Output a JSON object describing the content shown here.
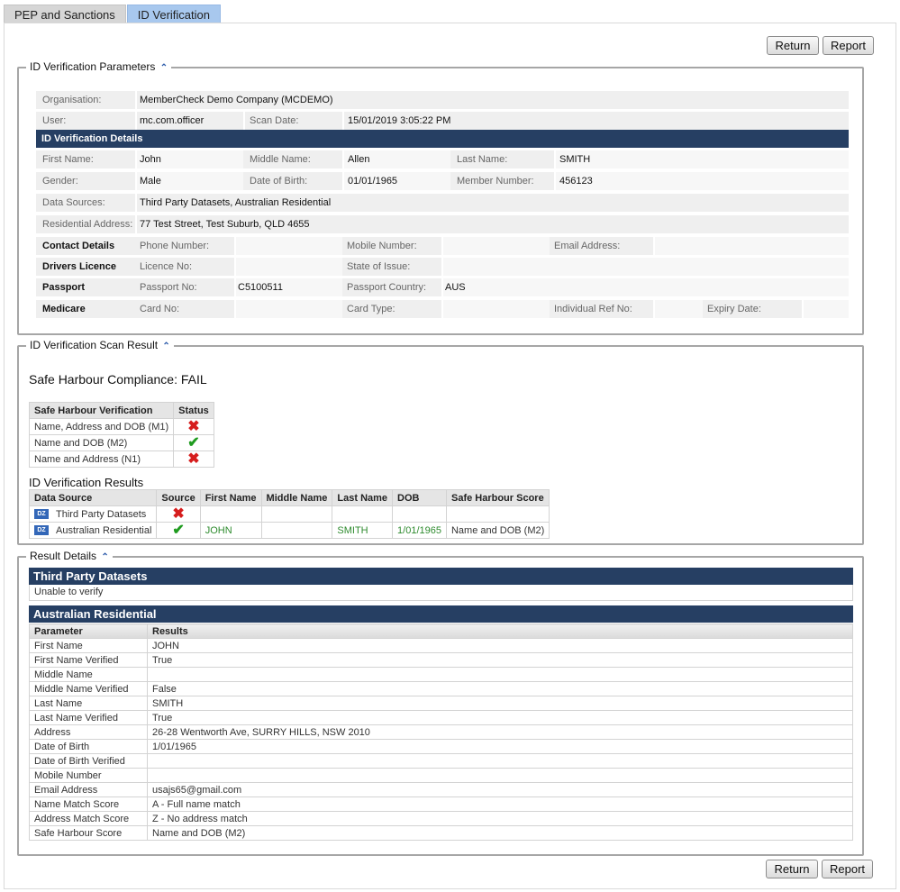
{
  "tabs": [
    {
      "label": "PEP and Sanctions",
      "active": false
    },
    {
      "label": "ID Verification",
      "active": true
    }
  ],
  "actions": {
    "return_label": "Return",
    "report_label": "Report"
  },
  "params": {
    "legend": "ID Verification Parameters",
    "organisation_label": "Organisation:",
    "organisation": "MemberCheck Demo Company (MCDEMO)",
    "user_label": "User:",
    "user": "mc.com.officer",
    "scan_date_label": "Scan Date:",
    "scan_date": "15/01/2019 3:05:22 PM",
    "details_header": "ID Verification Details",
    "first_name_label": "First Name:",
    "first_name": "John",
    "middle_name_label": "Middle Name:",
    "middle_name": "Allen",
    "last_name_label": "Last Name:",
    "last_name": "SMITH",
    "gender_label": "Gender:",
    "gender": "Male",
    "dob_label": "Date of Birth:",
    "dob": "01/01/1965",
    "member_number_label": "Member Number:",
    "member_number": "456123",
    "data_sources_label": "Data Sources:",
    "data_sources": "Third Party Datasets, Australian Residential",
    "address_label": "Residential Address:",
    "address": "77 Test Street, Test Suburb, QLD 4655",
    "contact_label": "Contact Details",
    "phone_label": "Phone Number:",
    "mobile_label": "Mobile Number:",
    "email_label": "Email Address:",
    "licence_label": "Drivers Licence",
    "licence_no_label": "Licence No:",
    "state_label": "State of Issue:",
    "passport_label": "Passport",
    "passport_no_label": "Passport No:",
    "passport_no": "C5100511",
    "passport_country_label": "Passport Country:",
    "passport_country": "AUS",
    "medicare_label": "Medicare",
    "card_no_label": "Card No:",
    "card_type_label": "Card Type:",
    "ref_no_label": "Individual Ref No:",
    "expiry_label": "Expiry Date:"
  },
  "scan": {
    "legend": "ID Verification Scan Result",
    "compliance": "Safe Harbour Compliance: FAIL",
    "sh_headers": [
      "Safe Harbour Verification",
      "Status"
    ],
    "sh_rows": [
      {
        "name": "Name, Address and DOB (M1)",
        "pass": false
      },
      {
        "name": "Name and DOB (M2)",
        "pass": true
      },
      {
        "name": "Name and Address (N1)",
        "pass": false
      }
    ],
    "results_title": "ID Verification Results",
    "res_headers": [
      "Data Source",
      "Source",
      "First Name",
      "Middle Name",
      "Last Name",
      "DOB",
      "Safe Harbour Score"
    ],
    "res_rows": [
      {
        "source": "Third Party Datasets",
        "pass": false,
        "first": "",
        "middle": "",
        "last": "",
        "dob": "",
        "score": ""
      },
      {
        "source": "Australian Residential",
        "pass": true,
        "first": "JOHN",
        "middle": "",
        "last": "SMITH",
        "dob": "1/01/1965",
        "score": "Name and DOB (M2)"
      }
    ],
    "icon_text": "DZ"
  },
  "details": {
    "legend": "Result Details",
    "tpd_title": "Third Party Datasets",
    "tpd_text": "Unable to verify",
    "ar_title": "Australian Residential",
    "headers": [
      "Parameter",
      "Results"
    ],
    "rows": [
      {
        "p": "First Name",
        "r": "JOHN"
      },
      {
        "p": "First Name Verified",
        "r": "True"
      },
      {
        "p": "Middle Name",
        "r": ""
      },
      {
        "p": "Middle Name Verified",
        "r": "False"
      },
      {
        "p": "Last Name",
        "r": "SMITH"
      },
      {
        "p": "Last Name Verified",
        "r": "True"
      },
      {
        "p": "Address",
        "r": "26-28 Wentworth Ave, SURRY HILLS, NSW 2010"
      },
      {
        "p": "Date of Birth",
        "r": "1/01/1965"
      },
      {
        "p": "Date of Birth Verified",
        "r": ""
      },
      {
        "p": "Mobile Number",
        "r": ""
      },
      {
        "p": "Email Address",
        "r": "usajs65@gmail.com"
      },
      {
        "p": "Name Match Score",
        "r": "A - Full name match"
      },
      {
        "p": "Address Match Score",
        "r": "Z - No address match"
      },
      {
        "p": "Safe Harbour Score",
        "r": "Name and DOB (M2)"
      }
    ]
  },
  "colors": {
    "header_navy": "#263f63",
    "active_tab": "#a8c8ee",
    "pass_green": "#1f9b1f",
    "fail_red": "#d61d1d"
  }
}
